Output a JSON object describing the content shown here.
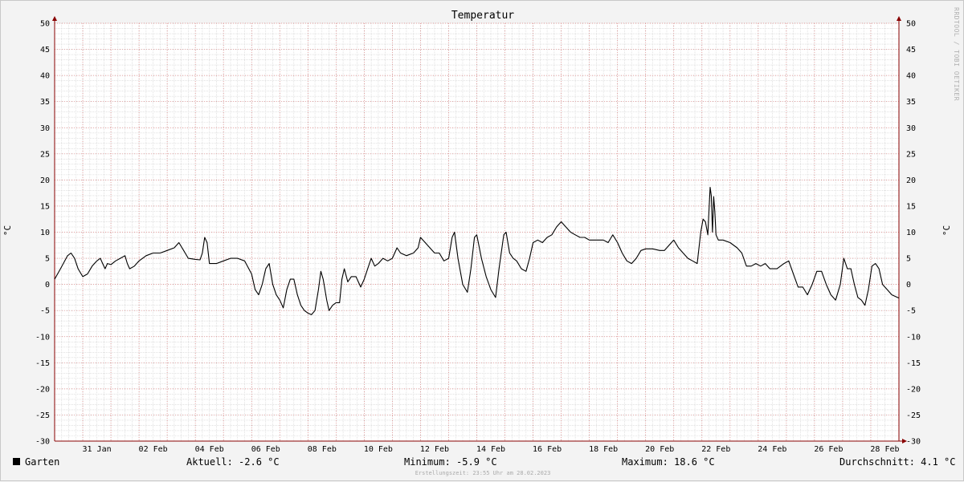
{
  "chart_data": {
    "type": "line",
    "title": "Temperatur",
    "ylabel": "°C",
    "ylim": [
      -30,
      50
    ],
    "yticks": [
      50,
      45,
      40,
      35,
      30,
      25,
      20,
      15,
      10,
      5,
      0,
      -5,
      -10,
      -15,
      -20,
      -25,
      -30
    ],
    "xrange": [
      "2023-01-30T00:00",
      "2023-03-01T00:00"
    ],
    "xticks": [
      "31 Jan",
      "02 Feb",
      "04 Feb",
      "06 Feb",
      "08 Feb",
      "10 Feb",
      "12 Feb",
      "14 Feb",
      "16 Feb",
      "18 Feb",
      "20 Feb",
      "22 Feb",
      "24 Feb",
      "26 Feb",
      "28 Feb"
    ],
    "grid": true,
    "series": [
      {
        "name": "Garten",
        "color": "#000000",
        "points": [
          [
            "2023-01-30T00:00",
            1.0
          ],
          [
            "2023-01-30T05:00",
            3.0
          ],
          [
            "2023-01-30T11:00",
            5.5
          ],
          [
            "2023-01-30T14:00",
            6.0
          ],
          [
            "2023-01-30T17:00",
            5.0
          ],
          [
            "2023-01-30T20:00",
            3.0
          ],
          [
            "2023-01-31T00:00",
            1.5
          ],
          [
            "2023-01-31T04:00",
            2.0
          ],
          [
            "2023-01-31T08:00",
            3.5
          ],
          [
            "2023-01-31T12:00",
            4.5
          ],
          [
            "2023-01-31T15:00",
            5.0
          ],
          [
            "2023-01-31T17:00",
            4.0
          ],
          [
            "2023-01-31T19:00",
            3.0
          ],
          [
            "2023-01-31T21:00",
            4.0
          ],
          [
            "2023-02-01T00:00",
            3.8
          ],
          [
            "2023-02-01T04:00",
            4.5
          ],
          [
            "2023-02-01T08:00",
            5.0
          ],
          [
            "2023-02-01T12:00",
            5.5
          ],
          [
            "2023-02-01T14:00",
            4.0
          ],
          [
            "2023-02-01T16:00",
            3.0
          ],
          [
            "2023-02-01T20:00",
            3.5
          ],
          [
            "2023-02-02T00:00",
            4.5
          ],
          [
            "2023-02-02T06:00",
            5.5
          ],
          [
            "2023-02-02T12:00",
            6.0
          ],
          [
            "2023-02-02T18:00",
            6.0
          ],
          [
            "2023-02-03T00:00",
            6.5
          ],
          [
            "2023-02-03T06:00",
            7.0
          ],
          [
            "2023-02-03T10:00",
            8.0
          ],
          [
            "2023-02-03T14:00",
            6.5
          ],
          [
            "2023-02-03T18:00",
            5.0
          ],
          [
            "2023-02-04T00:00",
            4.8
          ],
          [
            "2023-02-04T04:00",
            4.7
          ],
          [
            "2023-02-04T06:00",
            6.0
          ],
          [
            "2023-02-04T08:00",
            9.0
          ],
          [
            "2023-02-04T10:00",
            8.0
          ],
          [
            "2023-02-04T12:00",
            4.0
          ],
          [
            "2023-02-04T18:00",
            4.0
          ],
          [
            "2023-02-05T00:00",
            4.5
          ],
          [
            "2023-02-05T06:00",
            5.0
          ],
          [
            "2023-02-05T12:00",
            5.0
          ],
          [
            "2023-02-05T18:00",
            4.5
          ],
          [
            "2023-02-06T00:00",
            2.0
          ],
          [
            "2023-02-06T03:00",
            -1.0
          ],
          [
            "2023-02-06T06:00",
            -2.0
          ],
          [
            "2023-02-06T09:00",
            0.0
          ],
          [
            "2023-02-06T12:00",
            3.0
          ],
          [
            "2023-02-06T15:00",
            4.0
          ],
          [
            "2023-02-06T18:00",
            0.0
          ],
          [
            "2023-02-06T21:00",
            -2.0
          ],
          [
            "2023-02-07T00:00",
            -3.0
          ],
          [
            "2023-02-07T03:00",
            -4.5
          ],
          [
            "2023-02-07T06:00",
            -1.0
          ],
          [
            "2023-02-07T09:00",
            1.0
          ],
          [
            "2023-02-07T12:00",
            1.0
          ],
          [
            "2023-02-07T15:00",
            -2.0
          ],
          [
            "2023-02-07T18:00",
            -4.0
          ],
          [
            "2023-02-07T21:00",
            -5.0
          ],
          [
            "2023-02-08T00:00",
            -5.5
          ],
          [
            "2023-02-08T03:00",
            -5.8
          ],
          [
            "2023-02-08T06:00",
            -5.0
          ],
          [
            "2023-02-08T09:00",
            -1.0
          ],
          [
            "2023-02-08T11:00",
            2.5
          ],
          [
            "2023-02-08T13:00",
            1.0
          ],
          [
            "2023-02-08T16:00",
            -3.0
          ],
          [
            "2023-02-08T18:00",
            -5.0
          ],
          [
            "2023-02-08T21:00",
            -4.0
          ],
          [
            "2023-02-09T00:00",
            -3.5
          ],
          [
            "2023-02-09T03:00",
            -3.5
          ],
          [
            "2023-02-09T05:00",
            1.0
          ],
          [
            "2023-02-09T07:00",
            3.0
          ],
          [
            "2023-02-09T10:00",
            0.5
          ],
          [
            "2023-02-09T13:00",
            1.5
          ],
          [
            "2023-02-09T17:00",
            1.5
          ],
          [
            "2023-02-09T21:00",
            -0.5
          ],
          [
            "2023-02-10T00:00",
            1.0
          ],
          [
            "2023-02-10T03:00",
            3.0
          ],
          [
            "2023-02-10T06:00",
            5.0
          ],
          [
            "2023-02-10T09:00",
            3.5
          ],
          [
            "2023-02-10T12:00",
            4.0
          ],
          [
            "2023-02-10T16:00",
            5.0
          ],
          [
            "2023-02-10T20:00",
            4.5
          ],
          [
            "2023-02-11T00:00",
            5.0
          ],
          [
            "2023-02-11T04:00",
            7.0
          ],
          [
            "2023-02-11T07:00",
            6.0
          ],
          [
            "2023-02-11T12:00",
            5.5
          ],
          [
            "2023-02-11T18:00",
            6.0
          ],
          [
            "2023-02-11T22:00",
            7.0
          ],
          [
            "2023-02-12T00:00",
            9.0
          ],
          [
            "2023-02-12T04:00",
            8.0
          ],
          [
            "2023-02-12T08:00",
            7.0
          ],
          [
            "2023-02-12T12:00",
            6.0
          ],
          [
            "2023-02-12T16:00",
            6.0
          ],
          [
            "2023-02-12T20:00",
            4.5
          ],
          [
            "2023-02-13T00:00",
            5.0
          ],
          [
            "2023-02-13T03:00",
            9.0
          ],
          [
            "2023-02-13T05:00",
            10.0
          ],
          [
            "2023-02-13T08:00",
            5.0
          ],
          [
            "2023-02-13T12:00",
            0.0
          ],
          [
            "2023-02-13T16:00",
            -1.5
          ],
          [
            "2023-02-13T19:00",
            3.0
          ],
          [
            "2023-02-13T22:00",
            9.0
          ],
          [
            "2023-02-14T00:00",
            9.5
          ],
          [
            "2023-02-14T04:00",
            5.0
          ],
          [
            "2023-02-14T08:00",
            1.5
          ],
          [
            "2023-02-14T12:00",
            -1.0
          ],
          [
            "2023-02-14T16:00",
            -2.5
          ],
          [
            "2023-02-14T19:00",
            3.0
          ],
          [
            "2023-02-14T23:00",
            9.5
          ],
          [
            "2023-02-15T01:00",
            10.0
          ],
          [
            "2023-02-15T04:00",
            6.0
          ],
          [
            "2023-02-15T07:00",
            5.0
          ],
          [
            "2023-02-15T10:00",
            4.5
          ],
          [
            "2023-02-15T14:00",
            3.0
          ],
          [
            "2023-02-15T18:00",
            2.5
          ],
          [
            "2023-02-15T21:00",
            5.0
          ],
          [
            "2023-02-16T00:00",
            8.0
          ],
          [
            "2023-02-16T04:00",
            8.5
          ],
          [
            "2023-02-16T08:00",
            8.0
          ],
          [
            "2023-02-16T12:00",
            9.0
          ],
          [
            "2023-02-16T16:00",
            9.5
          ],
          [
            "2023-02-16T20:00",
            11.0
          ],
          [
            "2023-02-17T00:00",
            12.0
          ],
          [
            "2023-02-17T04:00",
            11.0
          ],
          [
            "2023-02-17T08:00",
            10.0
          ],
          [
            "2023-02-17T12:00",
            9.5
          ],
          [
            "2023-02-17T16:00",
            9.0
          ],
          [
            "2023-02-17T20:00",
            9.0
          ],
          [
            "2023-02-18T00:00",
            8.5
          ],
          [
            "2023-02-18T06:00",
            8.5
          ],
          [
            "2023-02-18T12:00",
            8.5
          ],
          [
            "2023-02-18T16:00",
            8.0
          ],
          [
            "2023-02-18T20:00",
            9.5
          ],
          [
            "2023-02-19T00:00",
            8.0
          ],
          [
            "2023-02-19T04:00",
            6.0
          ],
          [
            "2023-02-19T08:00",
            4.5
          ],
          [
            "2023-02-19T12:00",
            4.0
          ],
          [
            "2023-02-19T16:00",
            5.0
          ],
          [
            "2023-02-19T20:00",
            6.5
          ],
          [
            "2023-02-20T00:00",
            6.8
          ],
          [
            "2023-02-20T06:00",
            6.8
          ],
          [
            "2023-02-20T12:00",
            6.5
          ],
          [
            "2023-02-20T16:00",
            6.5
          ],
          [
            "2023-02-20T20:00",
            7.5
          ],
          [
            "2023-02-21T00:00",
            8.5
          ],
          [
            "2023-02-21T04:00",
            7.0
          ],
          [
            "2023-02-21T08:00",
            6.0
          ],
          [
            "2023-02-21T12:00",
            5.0
          ],
          [
            "2023-02-21T16:00",
            4.5
          ],
          [
            "2023-02-21T20:00",
            4.0
          ],
          [
            "2023-02-21T23:00",
            10.0
          ],
          [
            "2023-02-22T01:00",
            12.5
          ],
          [
            "2023-02-22T03:00",
            12.0
          ],
          [
            "2023-02-22T05:00",
            9.5
          ],
          [
            "2023-02-22T06:00",
            14.0
          ],
          [
            "2023-02-22T07:00",
            18.6
          ],
          [
            "2023-02-22T08:00",
            17.0
          ],
          [
            "2023-02-22T09:00",
            10.0
          ],
          [
            "2023-02-22T10:00",
            16.8
          ],
          [
            "2023-02-22T11:00",
            14.0
          ],
          [
            "2023-02-22T12:00",
            9.5
          ],
          [
            "2023-02-22T14:00",
            8.5
          ],
          [
            "2023-02-22T18:00",
            8.5
          ],
          [
            "2023-02-23T00:00",
            8.0
          ],
          [
            "2023-02-23T06:00",
            7.0
          ],
          [
            "2023-02-23T10:00",
            6.0
          ],
          [
            "2023-02-23T14:00",
            3.5
          ],
          [
            "2023-02-23T18:00",
            3.5
          ],
          [
            "2023-02-23T22:00",
            4.0
          ],
          [
            "2023-02-24T02:00",
            3.5
          ],
          [
            "2023-02-24T06:00",
            4.0
          ],
          [
            "2023-02-24T10:00",
            3.0
          ],
          [
            "2023-02-24T16:00",
            3.0
          ],
          [
            "2023-02-24T22:00",
            4.0
          ],
          [
            "2023-02-25T02:00",
            4.5
          ],
          [
            "2023-02-25T06:00",
            2.0
          ],
          [
            "2023-02-25T10:00",
            -0.5
          ],
          [
            "2023-02-25T14:00",
            -0.5
          ],
          [
            "2023-02-25T18:00",
            -2.0
          ],
          [
            "2023-02-25T22:00",
            0.0
          ],
          [
            "2023-02-26T02:00",
            2.5
          ],
          [
            "2023-02-26T06:00",
            2.5
          ],
          [
            "2023-02-26T10:00",
            0.0
          ],
          [
            "2023-02-26T14:00",
            -2.0
          ],
          [
            "2023-02-26T18:00",
            -3.0
          ],
          [
            "2023-02-26T22:00",
            0.0
          ],
          [
            "2023-02-27T01:00",
            5.0
          ],
          [
            "2023-02-27T04:00",
            3.0
          ],
          [
            "2023-02-27T07:00",
            3.0
          ],
          [
            "2023-02-27T10:00",
            0.0
          ],
          [
            "2023-02-27T13:00",
            -2.5
          ],
          [
            "2023-02-27T16:00",
            -3.0
          ],
          [
            "2023-02-27T19:00",
            -4.0
          ],
          [
            "2023-02-27T22:00",
            -1.0
          ],
          [
            "2023-02-28T01:00",
            3.5
          ],
          [
            "2023-02-28T04:00",
            4.0
          ],
          [
            "2023-02-28T07:00",
            3.0
          ],
          [
            "2023-02-28T10:00",
            0.0
          ],
          [
            "2023-02-28T14:00",
            -1.0
          ],
          [
            "2023-02-28T18:00",
            -2.0
          ],
          [
            "2023-02-28T23:55",
            -2.6
          ]
        ]
      }
    ]
  },
  "legend": {
    "series_name": "Garten",
    "current": "Aktuell: -2.6 °C",
    "minimum": "Minimum: -5.9 °C",
    "maximum": "Maximum: 18.6 °C",
    "average": "Durchschnitt: 4.1 °C"
  },
  "watermark": "RRDTOOL / TOBI OETIKER",
  "created": "Erstellungszeit: 23:55 Uhr am 28.02.2023",
  "colors": {
    "background": "#f3f3f3",
    "plot_background": "#ffffff",
    "major_grid": "#e08080",
    "minor_grid": "#d0d0d0",
    "axis": "#880000",
    "line": "#000000"
  }
}
